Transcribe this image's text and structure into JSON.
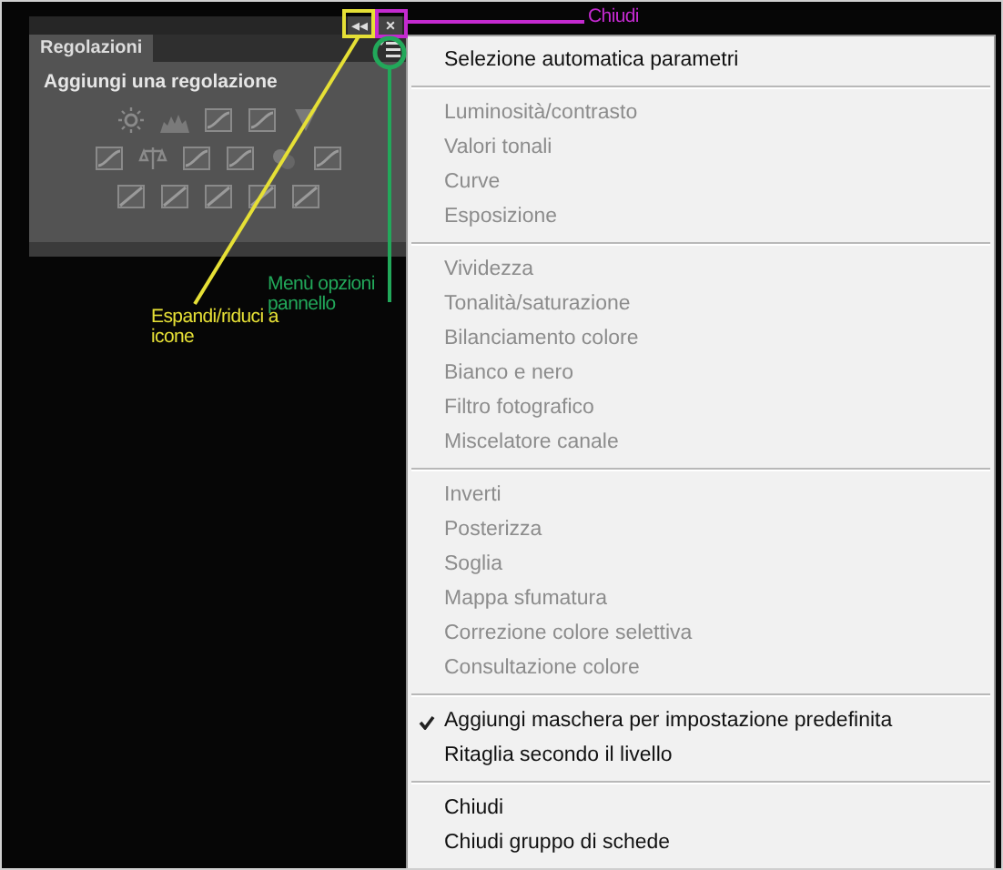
{
  "panel": {
    "tab": "Regolazioni",
    "heading": "Aggiungi una regolazione",
    "collapse_button": "◂◂",
    "close_button": "×"
  },
  "menu": {
    "groups": [
      [
        {
          "label": "Selezione automatica parametri",
          "disabled": false,
          "checked": false
        }
      ],
      [
        {
          "label": "Luminosità/contrasto",
          "disabled": true,
          "checked": false
        },
        {
          "label": "Valori tonali",
          "disabled": true,
          "checked": false
        },
        {
          "label": "Curve",
          "disabled": true,
          "checked": false
        },
        {
          "label": "Esposizione",
          "disabled": true,
          "checked": false
        }
      ],
      [
        {
          "label": "Vividezza",
          "disabled": true,
          "checked": false
        },
        {
          "label": "Tonalità/saturazione",
          "disabled": true,
          "checked": false
        },
        {
          "label": "Bilanciamento colore",
          "disabled": true,
          "checked": false
        },
        {
          "label": "Bianco e nero",
          "disabled": true,
          "checked": false
        },
        {
          "label": "Filtro fotografico",
          "disabled": true,
          "checked": false
        },
        {
          "label": "Miscelatore canale",
          "disabled": true,
          "checked": false
        }
      ],
      [
        {
          "label": "Inverti",
          "disabled": true,
          "checked": false
        },
        {
          "label": "Posterizza",
          "disabled": true,
          "checked": false
        },
        {
          "label": "Soglia",
          "disabled": true,
          "checked": false
        },
        {
          "label": "Mappa sfumatura",
          "disabled": true,
          "checked": false
        },
        {
          "label": "Correzione colore selettiva",
          "disabled": true,
          "checked": false
        },
        {
          "label": "Consultazione colore",
          "disabled": true,
          "checked": false
        }
      ],
      [
        {
          "label": "Aggiungi maschera per impostazione predefinita",
          "disabled": false,
          "checked": true
        },
        {
          "label": "Ritaglia secondo il livello",
          "disabled": false,
          "checked": false
        }
      ],
      [
        {
          "label": "Chiudi",
          "disabled": false,
          "checked": false
        },
        {
          "label": "Chiudi gruppo di schede",
          "disabled": false,
          "checked": false
        }
      ]
    ]
  },
  "annotations": [
    {
      "label": "Chiudi",
      "color": "#c42ad0"
    },
    {
      "label": "Espandi/riduci a icone",
      "color": "#e6e036"
    },
    {
      "label": "Menù opzioni pannello",
      "color": "#22a85a"
    }
  ]
}
